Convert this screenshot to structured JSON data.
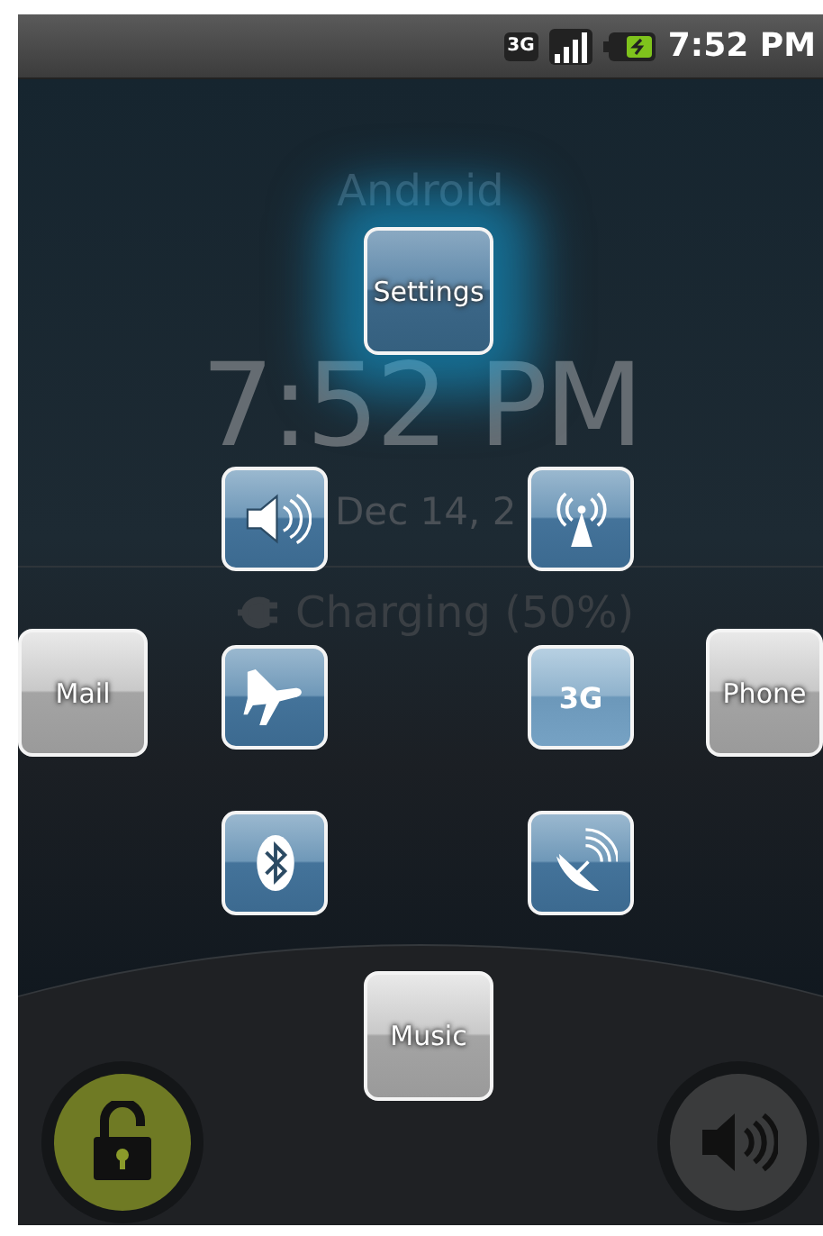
{
  "status_bar": {
    "time": "7:52 PM",
    "network": "3G"
  },
  "lock_screen": {
    "carrier": "Android",
    "time": "7:52 PM",
    "date": "Dec 14, 2",
    "charging": "Charging (50%)"
  },
  "quick_menu": [
    {
      "kind": "app",
      "label": "Settings",
      "selected": true
    },
    {
      "kind": "glyph",
      "selected": false
    },
    {
      "kind": "glyph",
      "selected": false
    },
    {
      "kind": "app",
      "label": "Mail",
      "selected": false
    },
    {
      "kind": "glyph",
      "selected": false
    },
    {
      "kind": "text",
      "label": "3G",
      "selected": false
    },
    {
      "kind": "app",
      "label": "Phone",
      "selected": false
    },
    {
      "kind": "glyph",
      "selected": false
    },
    {
      "kind": "glyph",
      "selected": false
    },
    {
      "kind": "app",
      "label": "Music",
      "selected": false
    }
  ]
}
